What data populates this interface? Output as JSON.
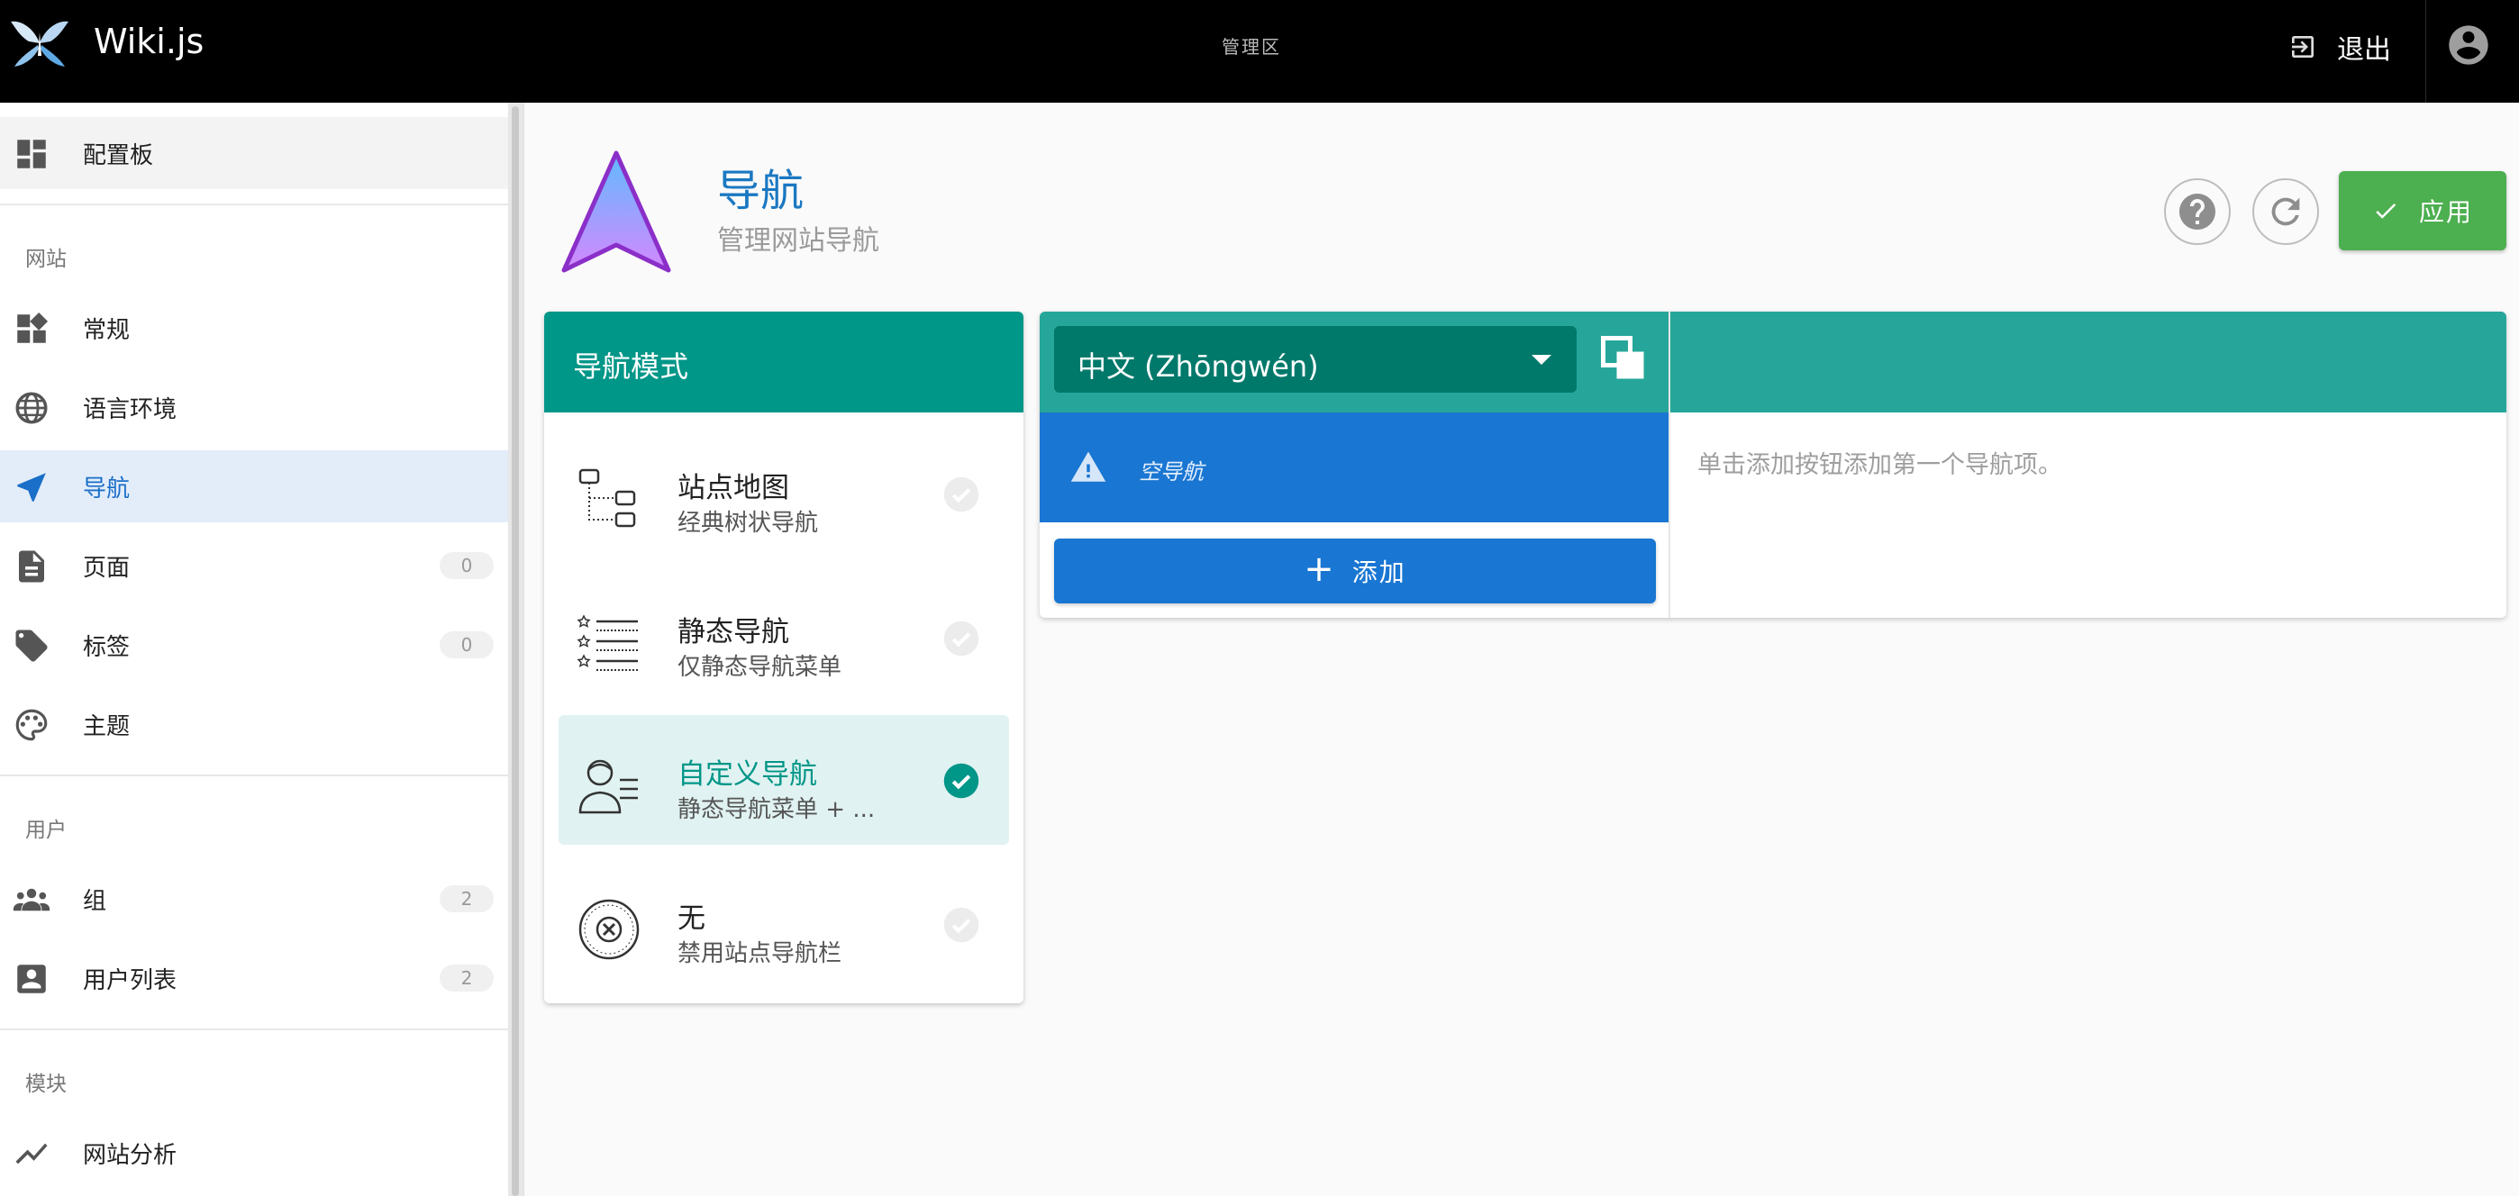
{
  "appbar": {
    "title": "Wiki.js",
    "center_label": "管理区",
    "logout_label": "退出"
  },
  "sidebar": {
    "dashboard": {
      "label": "配置板"
    },
    "sections": [
      {
        "title": "网站",
        "items": [
          {
            "label": "常规",
            "icon": "widgets-icon"
          },
          {
            "label": "语言环境",
            "icon": "globe-icon"
          },
          {
            "label": "导航",
            "icon": "navigation-icon",
            "active": true
          },
          {
            "label": "页面",
            "icon": "file-icon",
            "count": "0"
          },
          {
            "label": "标签",
            "icon": "tags-icon",
            "count": "0"
          },
          {
            "label": "主题",
            "icon": "palette-icon"
          }
        ]
      },
      {
        "title": "用户",
        "items": [
          {
            "label": "组",
            "icon": "groups-icon",
            "count": "2"
          },
          {
            "label": "用户列表",
            "icon": "user-box-icon",
            "count": "2"
          }
        ]
      },
      {
        "title": "模块",
        "items": [
          {
            "label": "网站分析",
            "icon": "chart-line-icon"
          }
        ]
      }
    ]
  },
  "header": {
    "title": "导航",
    "subtitle": "管理网站导航",
    "apply_label": "应用"
  },
  "mode_card": {
    "title": "导航模式",
    "options": [
      {
        "title": "站点地图",
        "subtitle": "经典树状导航",
        "icon": "sitemap-icon",
        "selected": false
      },
      {
        "title": "静态导航",
        "subtitle": "仅静态导航菜单",
        "icon": "static-list-icon",
        "selected": false
      },
      {
        "title": "自定义导航",
        "subtitle": "静态导航菜单 + ...",
        "icon": "custom-user-icon",
        "selected": true
      },
      {
        "title": "无",
        "subtitle": "禁用站点导航栏",
        "icon": "cancel-circle-icon",
        "selected": false
      }
    ]
  },
  "editor": {
    "locale_value": "中文 (Zhōngwén)",
    "empty_label": "空导航",
    "add_label": "添加",
    "hint": "单击添加按钮添加第一个导航项。"
  },
  "colors": {
    "teal": "#009688",
    "teal_light": "#26a69a",
    "blue": "#1976d2",
    "green": "#4caf50",
    "title_blue": "#1a78c2"
  }
}
